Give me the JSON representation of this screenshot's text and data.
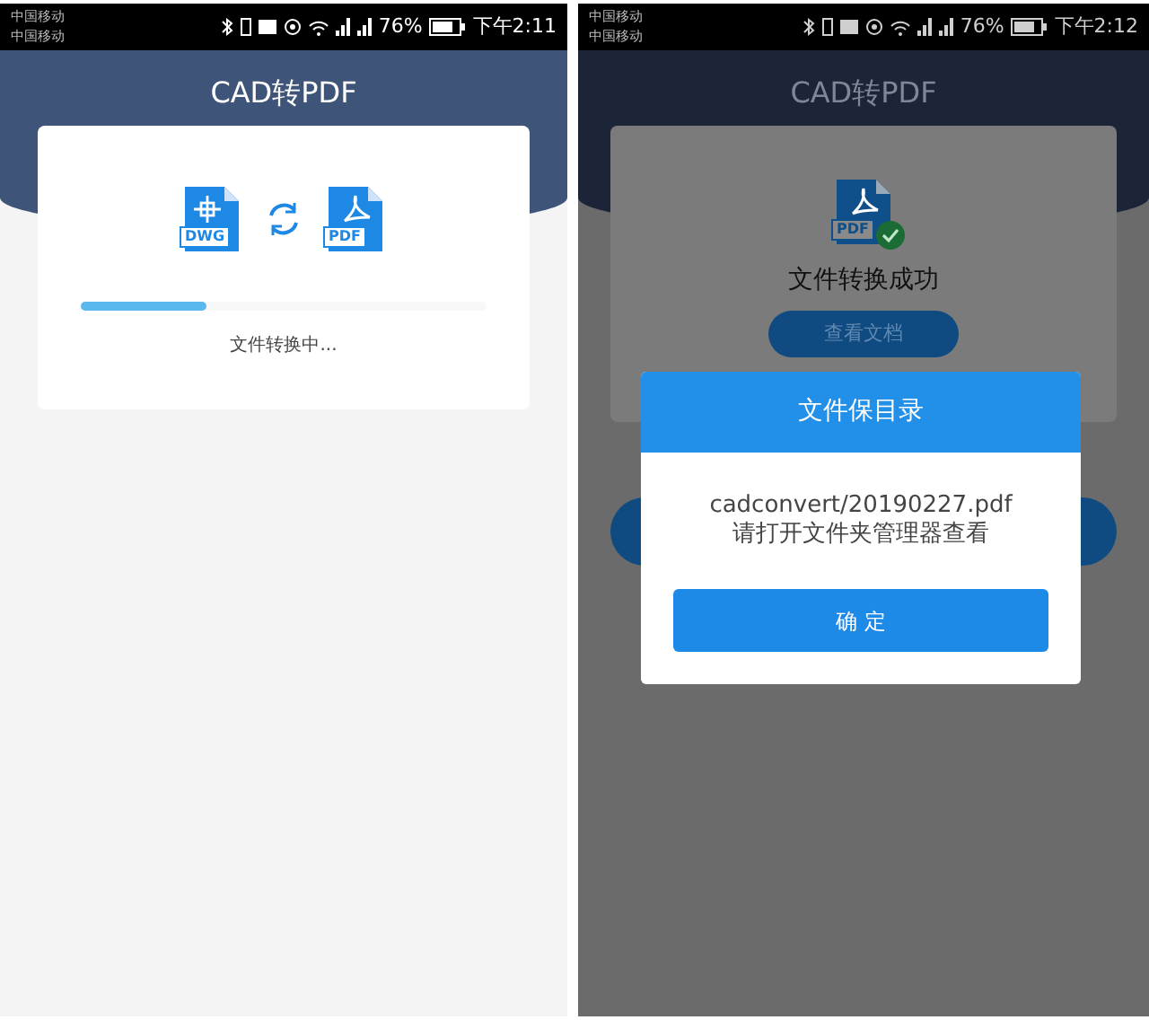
{
  "screens": [
    {
      "kind": "converting",
      "status_bar": {
        "carriers": [
          "中国移动",
          "中国移动"
        ],
        "battery": "76%",
        "time": "下午2:11"
      },
      "title": "CAD转PDF",
      "source_label": "DWG",
      "target_label": "PDF",
      "progress": {
        "level": 0.31,
        "label": "文件转换中..."
      }
    },
    {
      "kind": "done",
      "status_bar": {
        "carriers": [
          "中国移动",
          "中国移动"
        ],
        "battery": "76%",
        "time": "下午2:12"
      },
      "title": "CAD转PDF",
      "target_label": "PDF",
      "result": {
        "message": "文件转换成功",
        "button": "查看文档"
      },
      "dialog": {
        "title": "文件保目录",
        "path": "cadconvert/20190227.pdf",
        "hint": "请打开文件夹管理器查看",
        "confirm": "确 定"
      }
    }
  ]
}
